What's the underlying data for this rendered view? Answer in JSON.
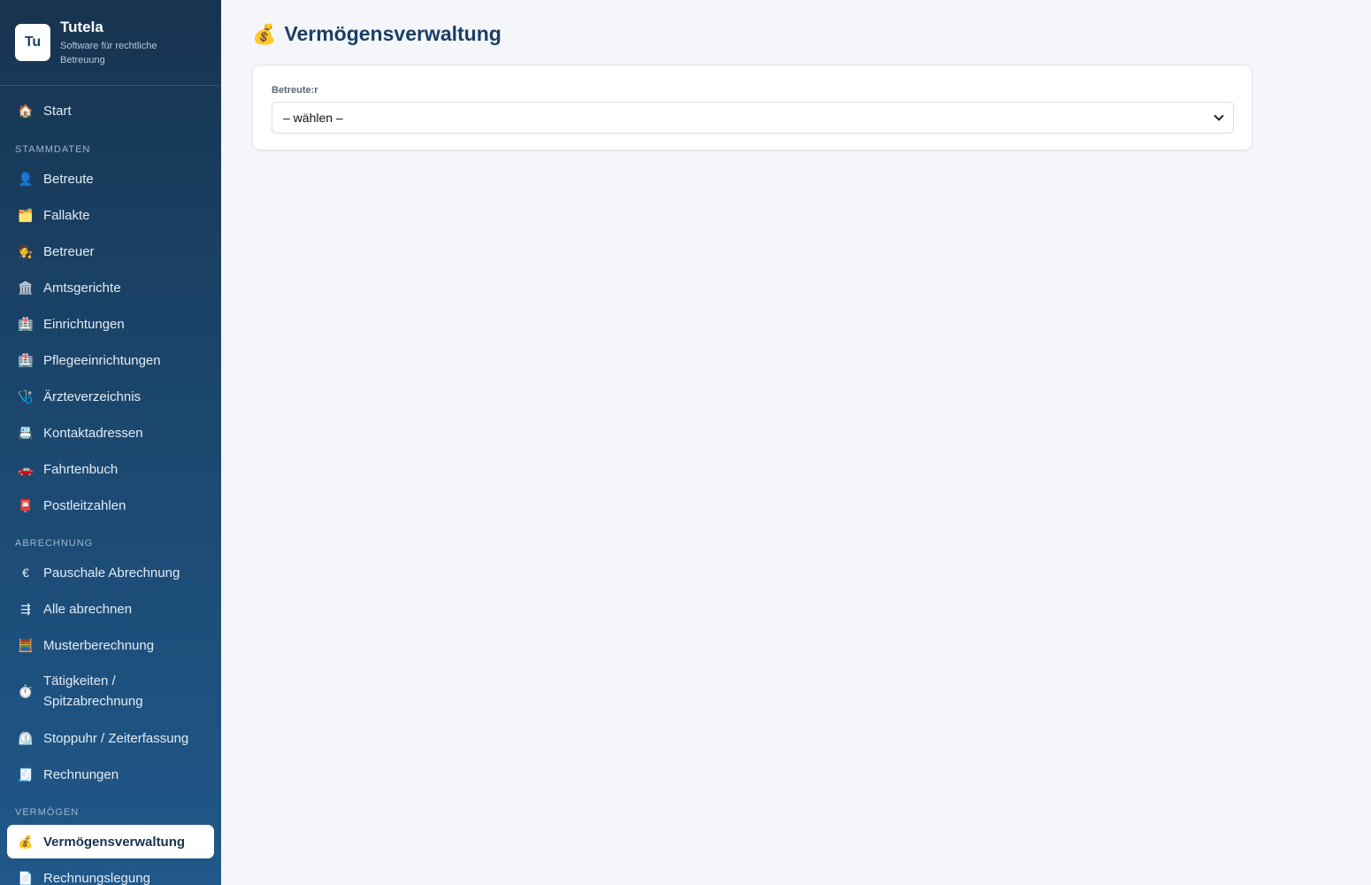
{
  "brand": {
    "logo": "Tu",
    "name": "Tutela",
    "subtitle": "Software für rechtliche Betreuung"
  },
  "sidebar": {
    "start": {
      "icon": "🏠",
      "label": "Start"
    },
    "sections": {
      "stammdaten": "STAMMDATEN",
      "abrechnung": "ABRECHNUNG",
      "vermoegen": "VERMÖGEN"
    },
    "items": [
      {
        "icon": "👤",
        "label": "Betreute"
      },
      {
        "icon": "🗂️",
        "label": "Fallakte"
      },
      {
        "icon": "🧑‍⚖️",
        "label": "Betreuer"
      },
      {
        "icon": "🏛️",
        "label": "Amtsgerichte"
      },
      {
        "icon": "🏥",
        "label": "Einrichtungen"
      },
      {
        "icon": "🏥",
        "label": "Pflegeeinrichtungen"
      },
      {
        "icon": "🩺",
        "label": "Ärzteverzeichnis"
      },
      {
        "icon": "📇",
        "label": "Kontaktadressen"
      },
      {
        "icon": "🚗",
        "label": "Fahrtenbuch"
      },
      {
        "icon": "📮",
        "label": "Postleitzahlen"
      }
    ],
    "abrechnung_items": [
      {
        "icon": "€",
        "label": "Pauschale Abrechnung"
      },
      {
        "icon": "⇶",
        "label": "Alle abrechnen"
      },
      {
        "icon": "🧮",
        "label": "Musterberechnung"
      },
      {
        "icon": "⏱️",
        "label": "Tätigkeiten / Spitzabrechnung"
      },
      {
        "icon": "⏲️",
        "label": "Stoppuhr / Zeiterfassung"
      },
      {
        "icon": "🧾",
        "label": "Rechnungen"
      }
    ],
    "vermoegen_items": [
      {
        "icon": "💰",
        "label": "Vermögensverwaltung",
        "active": true
      },
      {
        "icon": "📄",
        "label": "Rechnungslegung"
      }
    ]
  },
  "main": {
    "title_icon": "💰",
    "title": "Vermögensverwaltung",
    "field_label": "Betreute:r",
    "select_value": "– wählen –"
  }
}
